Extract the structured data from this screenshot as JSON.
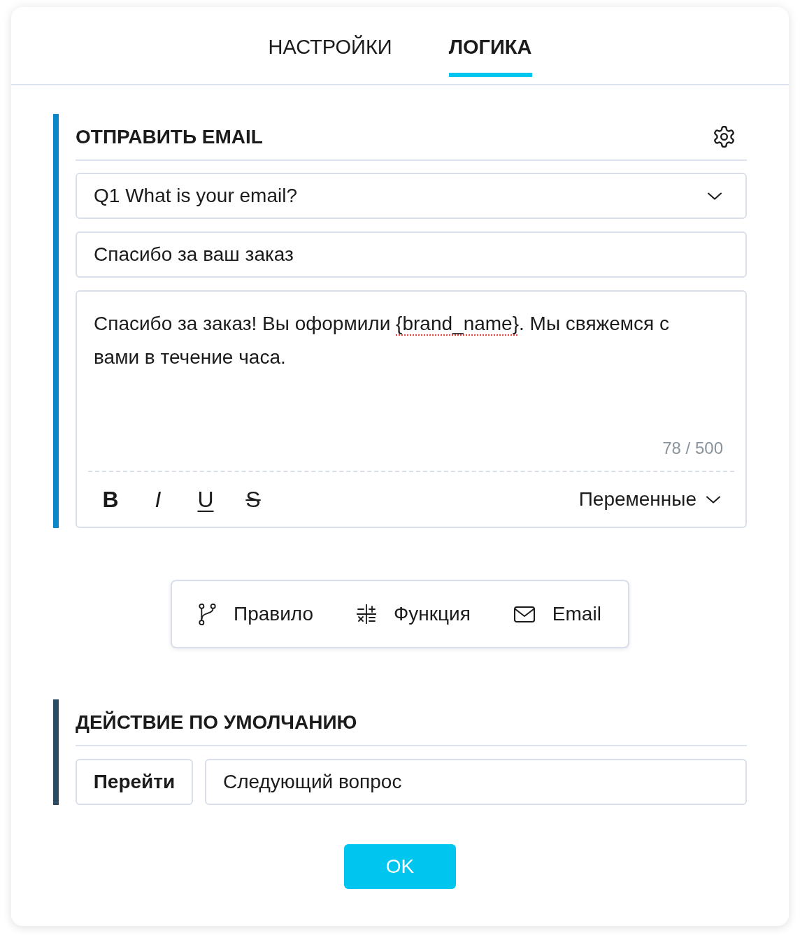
{
  "tabs": [
    {
      "label": "НАСТРОЙКИ",
      "selected": false
    },
    {
      "label": "ЛОГИКА",
      "selected": true
    }
  ],
  "blocks": [
    {
      "kind": "email",
      "title": "ОТПРАВИТЬ EMAIL",
      "color": "#0a85c7",
      "question_select": {
        "value": "Q1 What is your email?"
      },
      "subject_field": {
        "value": "Спасибо за ваш заказ"
      },
      "message": {
        "segments": [
          {
            "text": "Спасибо за заказ! Вы оформили ",
            "misspelled": false
          },
          {
            "text": "{brand_name}",
            "misspelled": true
          },
          {
            "text": ". Мы свяжемся с вами в течение часа.",
            "misspelled": false
          }
        ],
        "counter": "78 / 500",
        "format_buttons": [
          {
            "label": "B",
            "kind": "bold"
          },
          {
            "label": "I",
            "kind": "italic"
          },
          {
            "label": "U",
            "kind": "underline"
          },
          {
            "label": "S",
            "kind": "strike"
          }
        ],
        "variables_menu": "Переменные"
      }
    },
    {
      "kind": "add_actions",
      "items": [
        {
          "label": "Правило",
          "kind": "rule"
        },
        {
          "label": "Функция",
          "kind": "function"
        },
        {
          "label": "Email",
          "kind": "email"
        }
      ]
    },
    {
      "kind": "default",
      "title": "ДЕЙСТВИЕ ПО УМОЛЧАНИЮ",
      "color": "#2c4a60",
      "action": "Перейти",
      "target": "Следующий вопрос"
    }
  ],
  "ok_button": "OK"
}
